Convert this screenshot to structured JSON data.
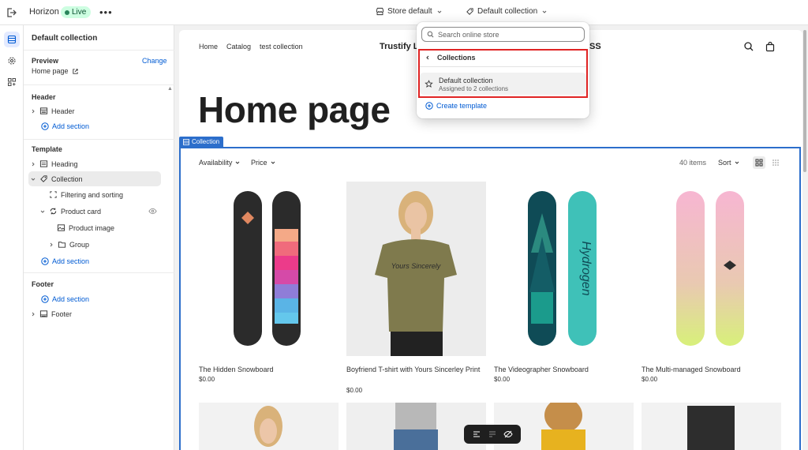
{
  "topbar": {
    "app_name": "Horizon",
    "live_label": "Live",
    "more": "•••",
    "store_select": "Store default",
    "template_select": "Default collection"
  },
  "sidebar": {
    "title": "Default collection",
    "preview_label": "Preview",
    "preview_change": "Change",
    "preview_page": "Home page",
    "header_group": "Header",
    "header_item": "Header",
    "add_section": "Add section",
    "template_group": "Template",
    "heading_item": "Heading",
    "collection_item": "Collection",
    "filtering_item": "Filtering and sorting",
    "product_card_item": "Product card",
    "product_image_item": "Product image",
    "group_item": "Group",
    "footer_group": "Footer",
    "footer_item": "Footer"
  },
  "preview": {
    "nav": [
      "Home",
      "Catalog",
      "test collection"
    ],
    "brand": "Trustify L",
    "brand_tail": "SS",
    "page_title": "Home page",
    "collection_tag": "Collection",
    "filters": [
      "Availability",
      "Price"
    ],
    "item_count": "40 items",
    "sort_label": "Sort",
    "products": [
      {
        "name": "The Hidden Snowboard",
        "price": "$0.00"
      },
      {
        "name": "Boyfriend T-shirt with Yours Sincerley Print",
        "price": "$0.00"
      },
      {
        "name": "The Videographer Snowboard",
        "price": "$0.00"
      },
      {
        "name": "The Multi-managed Snowboard",
        "price": "$0.00"
      }
    ]
  },
  "popover": {
    "search_placeholder": "Search online store",
    "back_label": "Collections",
    "item_title": "Default collection",
    "item_subtitle": "Assigned to 2 collections",
    "create_label": "Create template"
  },
  "colors": {
    "accent": "#005bd3",
    "selection_outline": "#2c6ecb",
    "live_bg": "#cdfee1",
    "highlight": "#e02424"
  }
}
